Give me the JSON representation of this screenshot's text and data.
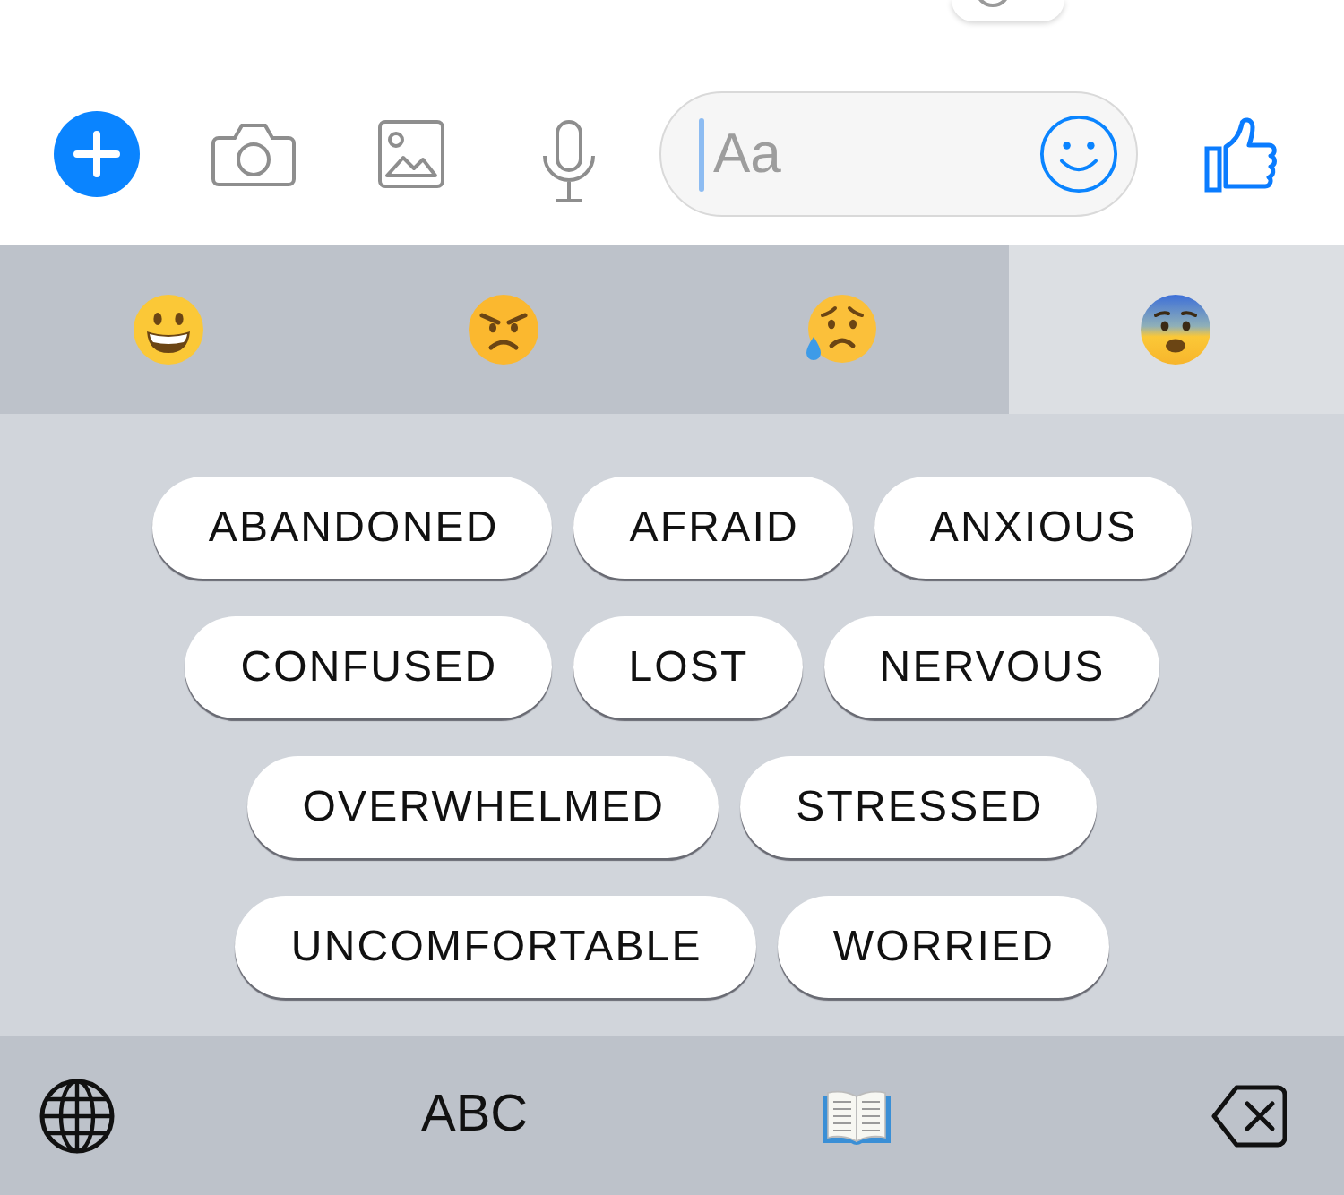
{
  "composer": {
    "placeholder": "Aa"
  },
  "emoji_tabs": [
    {
      "kind": "grinning",
      "selected": false
    },
    {
      "kind": "angry",
      "selected": false
    },
    {
      "kind": "sad_sweat",
      "selected": false
    },
    {
      "kind": "fearful",
      "selected": true
    }
  ],
  "feeling_rows": [
    [
      "ABANDONED",
      "AFRAID",
      "ANXIOUS"
    ],
    [
      "CONFUSED",
      "LOST",
      "NERVOUS"
    ],
    [
      "OVERWHELMED",
      "STRESSED"
    ],
    [
      "UNCOMFORTABLE",
      "WORRIED"
    ]
  ],
  "keyboard_bar": {
    "mode_key": "ABC"
  }
}
